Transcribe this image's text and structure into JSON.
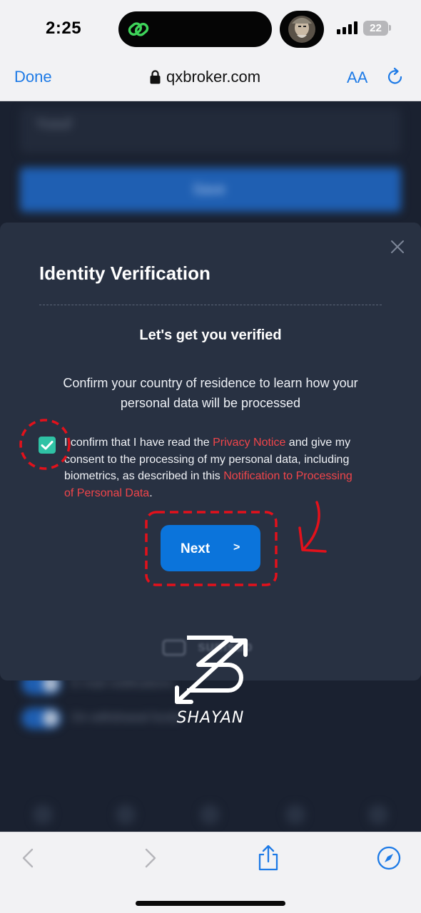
{
  "status_bar": {
    "time": "2:25",
    "battery": "22",
    "icons": [
      "link-icon",
      "avatar",
      "cellular-signal-icon",
      "battery-icon"
    ]
  },
  "browser": {
    "done_label": "Done",
    "url": "qxbroker.com",
    "text_size_label": "AA",
    "icons": [
      "lock-icon",
      "reload-icon",
      "back-icon",
      "forward-icon",
      "share-icon",
      "compass-icon"
    ]
  },
  "background_page": {
    "input_placeholder": "Yusuf",
    "button_label": "Save",
    "toggle_rows": [
      "E-mail notifications",
      "On withdrawal funds"
    ]
  },
  "modal": {
    "title": "Identity Verification",
    "subtitle": "Let's get you verified",
    "description": "Confirm your country of residence to learn how your personal data will be processed",
    "consent": {
      "checked": true,
      "text_before": "I confirm that I have read the ",
      "privacy_link": "Privacy Notice",
      "text_middle": " and give my consent to the processing of my personal data, including biometrics, as described in this ",
      "notification_link": "Notification to Processing of Personal Data",
      "text_after": "."
    },
    "next_button": {
      "label": "Next",
      "chevron": ">"
    },
    "powered_by": "sumsub"
  },
  "watermark": {
    "text": "SHAYAN"
  },
  "colors": {
    "accent": "#0b74db",
    "link": "#f0454a",
    "checkbox": "#2fc2a5",
    "modal_bg": "#283142",
    "annotation": "#e3111b",
    "safari_blue": "#1d7ae6"
  }
}
